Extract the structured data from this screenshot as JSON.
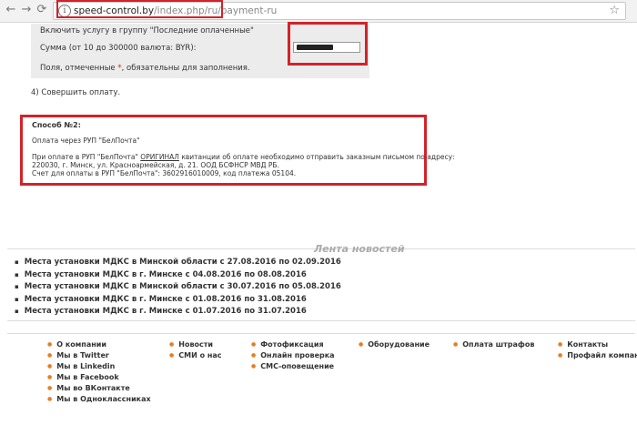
{
  "browser": {
    "back_icon": "←",
    "forward_icon": "→",
    "reload_icon": "⟳",
    "info_icon": "i",
    "star_icon": "☆",
    "url_host": "speed-control.by",
    "url_path": "/index.php/ru/payment-ru"
  },
  "form": {
    "service_label": "Включить услугу в группу \"Последние оплаченные\"",
    "sum_label": "Сумма (от 10 до 300000 валюта: BYR):",
    "required_note_pre": "Поля, отмеченные ",
    "required_star": "*",
    "required_note_post": ", обязательны для заполнения."
  },
  "step4": "4) Совершить оплату.",
  "method2": {
    "title": "Способ №2:",
    "line1": "Оплата через РУП \"БелПочта\"",
    "line2_pre": "При оплате в РУП \"БелПочта\" ",
    "line2_underlined": "ОРИГИНАЛ",
    "line2_post": " квитанции об оплате необходимо отправить заказным письмом по адресу:",
    "line3": "220030, г. Минск, ул. Красноармейская, д. 21. ООД БСФНСР МВД РБ.",
    "line4": "Счет для оплаты в РУП \"БелПочта\": 3602916010009, код платежа 05104."
  },
  "news": {
    "title": "Лента новостей",
    "items": [
      "Места установки МДКС в Минской области с 27.08.2016 по 02.09.2016",
      "Места установки МДКС в г. Минске с 04.08.2016 по 08.08.2016",
      "Места установки МДКС в Минской области с 30.07.2016 по 05.08.2016",
      "Места установки МДКС в г. Минске с 01.08.2016 по 31.08.2016",
      "Места установки МДКС в г. Минске с 01.07.2016 по 31.07.2016"
    ]
  },
  "footer": {
    "col1": [
      "О компании",
      "Мы в Twitter",
      "Мы в Linkedin",
      "Мы в Facebook",
      "Мы во ВКонтакте",
      "Мы в Одноклассниках"
    ],
    "col2": [
      "Новости",
      "СМИ о нас"
    ],
    "col3": [
      "Фотофиксация",
      "Онлайн проверка",
      "СМС-оповещение"
    ],
    "col4": [
      "Оборудование"
    ],
    "col5": [
      "Оплата штрафов"
    ],
    "col6": [
      "Контакты",
      "Профайл компании"
    ]
  },
  "colors": {
    "highlight": "#d2232a",
    "bullet": "#e67e22",
    "form_bg": "#ececec"
  }
}
